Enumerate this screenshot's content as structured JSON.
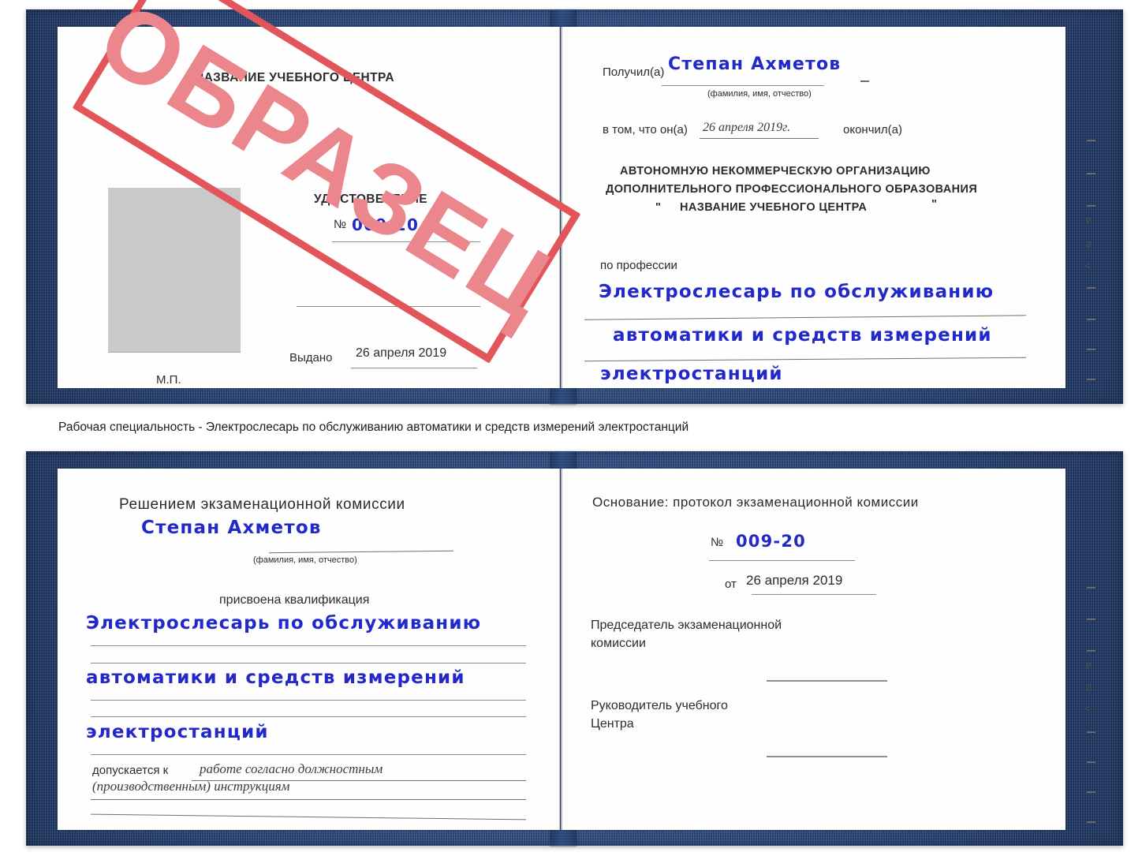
{
  "document": {
    "type": "Удостоверение",
    "stamp_text": "ОБРАЗЕЦ",
    "stamp_color": "#e2565b",
    "stamp_fill_color": "#eb868d",
    "cover_color": "#22407a",
    "handwriting_color": "#2229c8"
  },
  "caption": {
    "text": "Рабочая специальность - Электрослесарь по обслуживанию автоматики и средств измерений электростанций"
  },
  "certificate_top": {
    "left_page": {
      "header": "НАЗВАНИЕ УЧЕБНОГО ЦЕНТРА",
      "title": "УДОСТОВЕРЕНИЕ",
      "number_label": "№",
      "number_value": "009-20",
      "issued_label": "Выдано",
      "issued_value": "26 апреля 2019",
      "seal_label": "М.П.",
      "photo_placeholder": "photo-placeholder"
    },
    "right_page": {
      "received_label": "Получил(а)",
      "received_value": "Степан Ахметов",
      "name_hint": "(фамилия, имя, отчество)",
      "in_that_label": "в том, что он(а)",
      "in_that_date": "26 апреля 2019г.",
      "finished_label": "окончил(а)",
      "org_line1": "АВТОНОМНУЮ НЕКОММЕРЧЕСКУЮ ОРГАНИЗАЦИЮ",
      "org_line2": "ДОПОЛНИТЕЛЬНОГО ПРОФЕССИОНАЛЬНОГО ОБРАЗОВАНИЯ",
      "org_quote_open": "\"",
      "org_line3": "НАЗВАНИЕ УЧЕБНОГО ЦЕНТРА",
      "org_quote_close": "\"",
      "profession_label": "по профессии",
      "profession_line1": "Электрослесарь по обслуживанию",
      "profession_line2": "автоматики и средств измерений",
      "profession_line3": "электростанций",
      "edge_glyphs": [
        "и",
        "а",
        "<-"
      ]
    }
  },
  "certificate_bottom": {
    "left_page": {
      "header": "Решением экзаменационной комиссии",
      "name_value": "Степан Ахметов",
      "name_hint": "(фамилия, имя, отчество)",
      "qualification_label": "присвоена квалификация",
      "qualification_line1": "Электрослесарь по обслуживанию",
      "qualification_line2": "автоматики и средств измерений",
      "qualification_line3": "электростанций",
      "admitted_label": "допускается к",
      "admitted_line1": "работе согласно должностным",
      "admitted_line2": "(производственным) инструкциям"
    },
    "right_page": {
      "basis_label": "Основание: протокол экзаменационной комиссии",
      "number_label": "№",
      "number_value": "009-20",
      "date_label": "от",
      "date_value": "26 апреля 2019",
      "chairman_line1": "Председатель экзаменационной",
      "chairman_line2": "комиссии",
      "head_line1": "Руководитель учебного",
      "head_line2": "Центра",
      "edge_glyphs": [
        "и",
        "а",
        "<-"
      ]
    }
  }
}
